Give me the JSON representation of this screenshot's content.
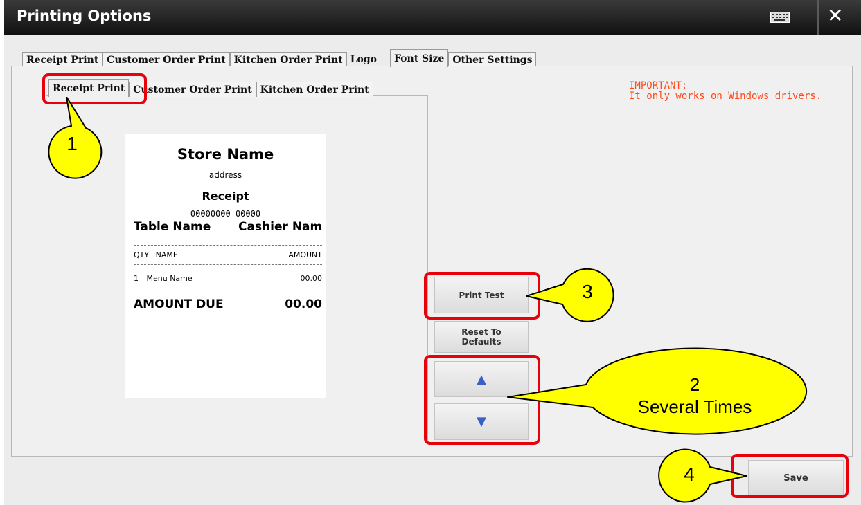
{
  "window": {
    "title": "Printing Options",
    "keyboard_icon": "keyboard-icon",
    "close_icon": "close-icon",
    "close_glyph": "✕"
  },
  "main_tabs": [
    {
      "label": "Receipt Print"
    },
    {
      "label": "Customer Order Print"
    },
    {
      "label": "Kitchen Order Print"
    },
    {
      "label": "Logo"
    },
    {
      "label": "Font Size",
      "active": true
    },
    {
      "label": "Other Settings"
    }
  ],
  "sub_tabs": [
    {
      "label": "Receipt Print",
      "active": true
    },
    {
      "label": "Customer Order Print"
    },
    {
      "label": "Kitchen Order Print"
    }
  ],
  "preview": {
    "store_name": "Store Name",
    "address": "address",
    "title": "Receipt",
    "receipt_number": "00000000-00000",
    "table_name": "Table Name",
    "cashier_name": "Cashier Nam",
    "col_qty": "QTY",
    "col_name": "NAME",
    "col_amount": "AMOUNT",
    "item_qty": "1",
    "item_name": "Menu Name",
    "item_amount": "00.00",
    "amount_due_label": "AMOUNT DUE",
    "amount_due_value": "00.00"
  },
  "buttons": {
    "print_test": "Print Test",
    "reset_line1": "Reset To",
    "reset_line2": "Defaults",
    "up_glyph": "▲",
    "down_glyph": "▼",
    "save": "Save"
  },
  "notice": {
    "line1": "IMPORTANT:",
    "line2": "It only works on Windows drivers."
  },
  "callouts": {
    "c1": "1",
    "c2_number": "2",
    "c2_text": "Several Times",
    "c3": "3",
    "c4": "4"
  },
  "colors": {
    "highlight": "#e8000b",
    "callout_fill": "#ffff00",
    "notice": "#ff4a1a",
    "arrow_blue": "#3a5fc8"
  }
}
